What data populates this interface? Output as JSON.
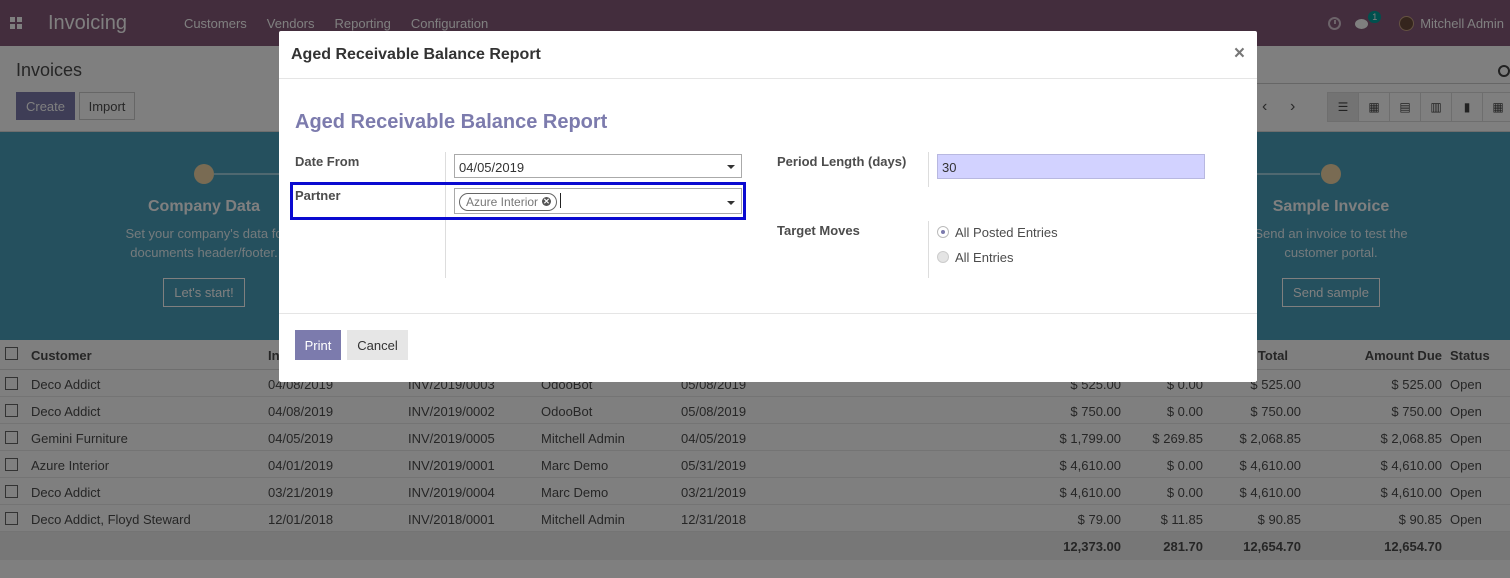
{
  "navbar": {
    "app_title": "Invoicing",
    "menu": [
      "Customers",
      "Vendors",
      "Reporting",
      "Configuration"
    ],
    "chat_count": "1",
    "user_name": "Mitchell Admin"
  },
  "control_panel": {
    "breadcrumb": "Invoices",
    "create_label": "Create",
    "import_label": "Import",
    "pager_prev": "‹",
    "pager_next": "›"
  },
  "banner": {
    "steps": [
      {
        "title": "Company Data",
        "desc_line1": "Set your company's data fo",
        "desc_line2": "documents header/footer.",
        "button": "Let's start!"
      },
      {
        "title": "Sample Invoice",
        "desc_line1": "Send an invoice to test the",
        "desc_line2": "customer portal.",
        "button": "Send sample"
      }
    ]
  },
  "table": {
    "headers": {
      "customer": "Customer",
      "in": "In",
      "total": "Total",
      "amount_due": "Amount Due",
      "status": "Status"
    },
    "rows": [
      {
        "customer": "Deco Addict",
        "date": "04/08/2019",
        "number": "INV/2019/0003",
        "salesperson": "OdooBot",
        "due": "05/08/2019",
        "untaxed": "$ 525.00",
        "tax": "$ 0.00",
        "total": "$ 525.00",
        "amount_due": "$ 525.00",
        "status": "Open"
      },
      {
        "customer": "Deco Addict",
        "date": "04/08/2019",
        "number": "INV/2019/0002",
        "salesperson": "OdooBot",
        "due": "05/08/2019",
        "untaxed": "$ 750.00",
        "tax": "$ 0.00",
        "total": "$ 750.00",
        "amount_due": "$ 750.00",
        "status": "Open"
      },
      {
        "customer": "Gemini Furniture",
        "date": "04/05/2019",
        "number": "INV/2019/0005",
        "salesperson": "Mitchell Admin",
        "due": "04/05/2019",
        "untaxed": "$ 1,799.00",
        "tax": "$ 269.85",
        "total": "$ 2,068.85",
        "amount_due": "$ 2,068.85",
        "status": "Open"
      },
      {
        "customer": "Azure Interior",
        "date": "04/01/2019",
        "number": "INV/2019/0001",
        "salesperson": "Marc Demo",
        "due": "05/31/2019",
        "untaxed": "$ 4,610.00",
        "tax": "$ 0.00",
        "total": "$ 4,610.00",
        "amount_due": "$ 4,610.00",
        "status": "Open"
      },
      {
        "customer": "Deco Addict",
        "date": "03/21/2019",
        "number": "INV/2019/0004",
        "salesperson": "Marc Demo",
        "due": "03/21/2019",
        "untaxed": "$ 4,610.00",
        "tax": "$ 0.00",
        "total": "$ 4,610.00",
        "amount_due": "$ 4,610.00",
        "status": "Open"
      },
      {
        "customer": "Deco Addict, Floyd Steward",
        "date": "12/01/2018",
        "number": "INV/2018/0001",
        "salesperson": "Mitchell Admin",
        "due": "12/31/2018",
        "untaxed": "$ 79.00",
        "tax": "$ 11.85",
        "total": "$ 90.85",
        "amount_due": "$ 90.85",
        "status": "Open"
      }
    ],
    "footer": {
      "untaxed": "12,373.00",
      "tax": "281.70",
      "total": "12,654.70",
      "amount_due": "12,654.70"
    }
  },
  "modal": {
    "title": "Aged Receivable Balance Report",
    "close_glyph": "×",
    "form_title": "Aged Receivable Balance Report",
    "date_from_label": "Date From",
    "date_from_value": "04/05/2019",
    "partner_label": "Partner",
    "partner_tag": "Azure Interior",
    "period_label": "Period Length (days)",
    "period_value": "30",
    "target_moves_label": "Target Moves",
    "target_options": [
      "All Posted Entries",
      "All Entries"
    ],
    "print_label": "Print",
    "cancel_label": "Cancel"
  }
}
